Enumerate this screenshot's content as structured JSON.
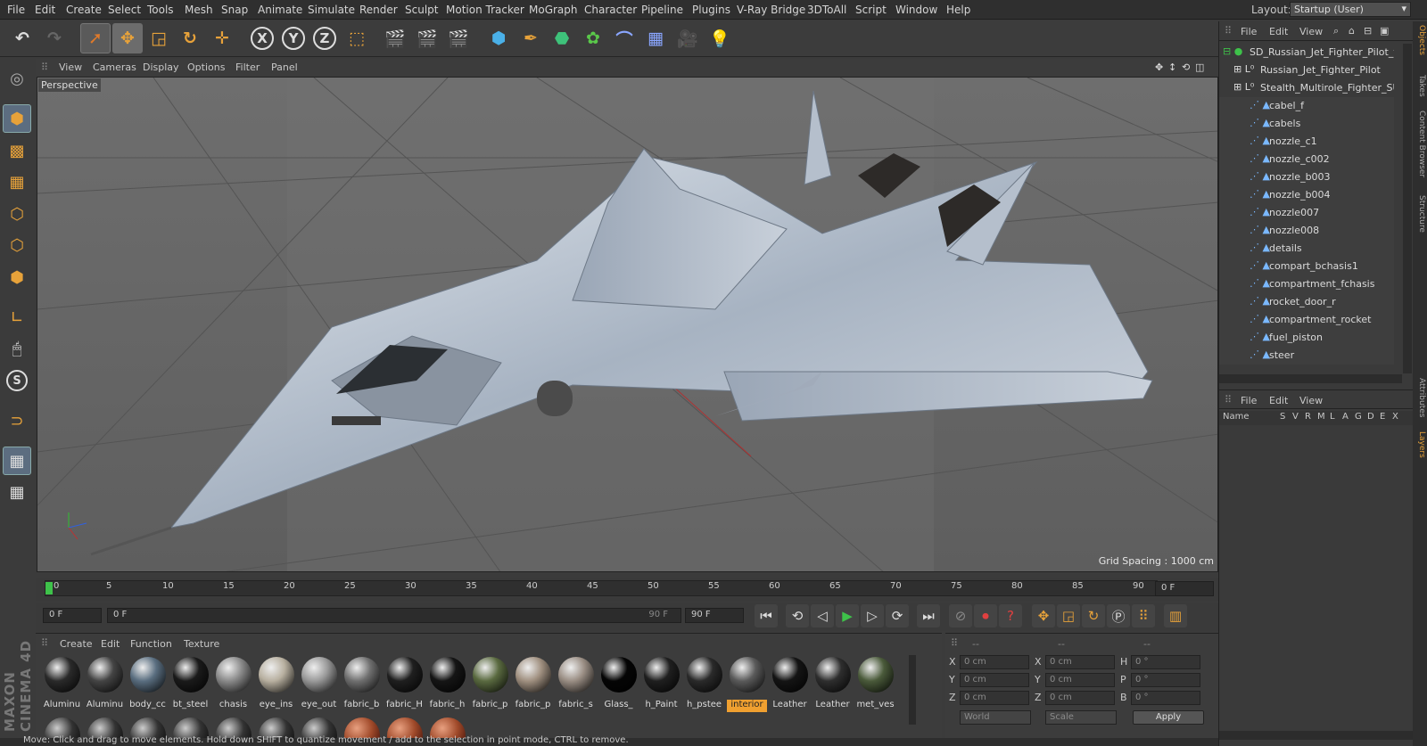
{
  "menu": [
    "File",
    "Edit",
    "Create",
    "Select",
    "Tools",
    "Mesh",
    "Snap",
    "Animate",
    "Simulate",
    "Render",
    "Sculpt",
    "Motion Tracker",
    "MoGraph",
    "Character",
    "Pipeline",
    "Plugins",
    "V-Ray Bridge",
    "3DToAll",
    "Script",
    "Window",
    "Help"
  ],
  "layout": {
    "label": "Layout:",
    "value": "Startup (User)"
  },
  "toolbar": {
    "undo": "↶",
    "redo": "↷",
    "axis_x": "X",
    "axis_y": "Y",
    "axis_z": "Z"
  },
  "viewport": {
    "menu": [
      "View",
      "Cameras",
      "Display",
      "Options",
      "Filter",
      "Panel"
    ],
    "label": "Perspective",
    "grid_spacing": "Grid Spacing : 1000 cm"
  },
  "timeline": {
    "ticks": [
      "0",
      "5",
      "10",
      "15",
      "20",
      "25",
      "30",
      "35",
      "40",
      "45",
      "50",
      "55",
      "60",
      "65",
      "70",
      "75",
      "80",
      "85",
      "90"
    ],
    "frame_end_field": "0 F"
  },
  "controls": {
    "start": "0 F",
    "slider_left": "0 F",
    "slider_right": "90 F",
    "end": "90 F"
  },
  "materials": {
    "menu": [
      "Create",
      "Edit",
      "Function",
      "Texture"
    ],
    "items": [
      {
        "name": "Aluminu",
        "color": "#2a2a2a"
      },
      {
        "name": "Aluminu",
        "color": "#444"
      },
      {
        "name": "body_cc",
        "color": "#5a6e80"
      },
      {
        "name": "bt_steel",
        "color": "#1a1a1a"
      },
      {
        "name": "chasis",
        "color": "#8a8a8a"
      },
      {
        "name": "eye_ins",
        "color": "#b8b0a0"
      },
      {
        "name": "eye_out",
        "color": "#9a9a9a"
      },
      {
        "name": "fabric_b",
        "color": "#707070"
      },
      {
        "name": "fabric_H",
        "color": "#1f1f1f"
      },
      {
        "name": "fabric_h",
        "color": "#151515"
      },
      {
        "name": "fabric_p",
        "color": "#5a6a40"
      },
      {
        "name": "fabric_p",
        "color": "#a09080"
      },
      {
        "name": "fabric_s",
        "color": "#9a8e84"
      },
      {
        "name": "Glass_",
        "color": "#050505"
      },
      {
        "name": "h_Paint",
        "color": "#1f1f1f"
      },
      {
        "name": "h_pstee",
        "color": "#2a2a2a"
      },
      {
        "name": "interior",
        "color": "#5a5a5a"
      },
      {
        "name": "Leather",
        "color": "#141414"
      },
      {
        "name": "Leather",
        "color": "#2e2e2e"
      },
      {
        "name": "met_ves",
        "color": "#4a5a3a"
      }
    ]
  },
  "coords": {
    "x": "0 cm",
    "y": "0 cm",
    "z": "0 cm",
    "sx": "0 cm",
    "sy": "0 cm",
    "sz": "0 cm",
    "h": "0 °",
    "p": "0 °",
    "b": "0 °",
    "mode": "World",
    "scale": "Scale",
    "apply": "Apply",
    "col1": "--",
    "col2": "--",
    "col3": "--"
  },
  "status": "Move: Click and drag to move elements. Hold down SHIFT to quantize movement / add to the selection in point mode, CTRL to remove.",
  "objects": {
    "menu": [
      "File",
      "Edit",
      "View"
    ],
    "items": [
      "SD_Russian_Jet_Fighter_Pilot_tu",
      "Russian_Jet_Fighter_Pilot",
      "Stealth_Multirole_Fighter_SU_",
      "cabel_f",
      "cabels",
      "nozzle_c1",
      "nozzle_c002",
      "nozzle_b003",
      "nozzle_b004",
      "nozzle007",
      "nozzle008",
      "details",
      "compart_bchasis1",
      "compartment_fchasis",
      "rocket_door_r",
      "compartment_rocket",
      "fuel_piston",
      "steer"
    ]
  },
  "layers": {
    "menu": [
      "File",
      "Edit",
      "View"
    ],
    "name_col": "Name",
    "flags": [
      "S",
      "V",
      "R",
      "M",
      "L",
      "A",
      "G",
      "D",
      "E",
      "X"
    ]
  },
  "side_tabs": [
    "Objects",
    "Takes",
    "Content Browser",
    "Structure",
    "Attributes",
    "Layers"
  ],
  "brand": "MAXON CINEMA 4D"
}
